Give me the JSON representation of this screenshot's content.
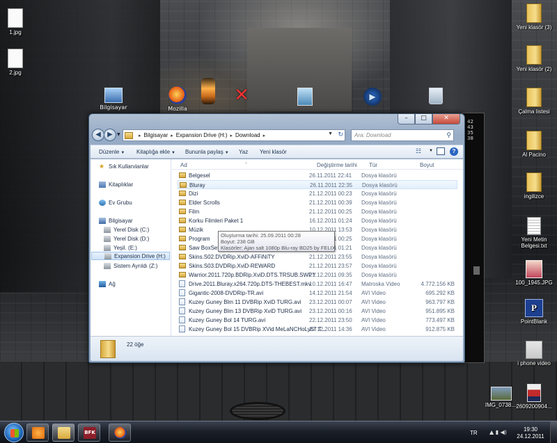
{
  "desktop": {
    "left_icons": [
      {
        "label": "1.jpg"
      },
      {
        "label": "2.jpg"
      }
    ],
    "top_icons": [
      {
        "label": "Bilgisayar"
      },
      {
        "label": "Mozilla"
      }
    ],
    "right_icons": [
      {
        "label": "Yeni klasör (3)"
      },
      {
        "label": "Yeni klasör (2)"
      },
      {
        "label": "Çalma listesi"
      },
      {
        "label": "Al Pacino"
      },
      {
        "label": "ingilizce"
      },
      {
        "label": "Yeni Metin Belgesi.txt"
      },
      {
        "label": "100_1945.JPG"
      },
      {
        "label": "PointBlank"
      },
      {
        "label": "i phone video"
      },
      {
        "label": "IMG_0738...."
      },
      {
        "label": "2609200904..."
      }
    ],
    "console_lines": [
      "42",
      "43",
      "35",
      "38"
    ]
  },
  "explorer": {
    "caption": {
      "minimize": "–",
      "maximize": "□",
      "close": "✕"
    },
    "address": {
      "crumbs": [
        "Bilgisayar",
        "Expansion Drive (H:)",
        "Download"
      ],
      "separator": "▸"
    },
    "search": {
      "placeholder": "Ara: Download"
    },
    "toolbar": {
      "organize": "Düzenle",
      "add_to_library": "Kitaplığa ekle",
      "share_with": "Bununla paylaş",
      "burn": "Yaz",
      "new_folder": "Yeni klasör"
    },
    "nav": {
      "favorites": "Sık Kullanılanlar",
      "libraries": "Kitaplıklar",
      "homegroup": "Ev Grubu",
      "computer": "Bilgisayar",
      "drives": [
        "Yerel Disk (C:)",
        "Yerel Disk (D:)",
        "Yeşil. (E:)",
        "Expansion Drive (H:)",
        "Sistem Ayrıldı (Z:)"
      ],
      "network": "Ağ"
    },
    "columns": {
      "name": "Ad",
      "date": "Değiştirme tarihi",
      "type": "Tür",
      "size": "Boyut"
    },
    "files": [
      {
        "name": "Belgesel",
        "date": "26.11.2011 22:41",
        "type": "Dosya klasörü",
        "size": "",
        "kind": "folder"
      },
      {
        "name": "Bluray",
        "date": "26.11.2011 22:35",
        "type": "Dosya klasörü",
        "size": "",
        "kind": "folder"
      },
      {
        "name": "Dizi",
        "date": "21.12.2011 00:23",
        "type": "Dosya klasörü",
        "size": "",
        "kind": "folder"
      },
      {
        "name": "Elder Scrolls",
        "date": "21.12.2011 00:39",
        "type": "Dosya klasörü",
        "size": "",
        "kind": "folder"
      },
      {
        "name": "Film",
        "date": "21.12.2011 00:25",
        "type": "Dosya klasörü",
        "size": "",
        "kind": "folder"
      },
      {
        "name": "Korku Filmleri Paket 1",
        "date": "16.12.2011 01:24",
        "type": "Dosya klasörü",
        "size": "",
        "kind": "folder"
      },
      {
        "name": "Müzik",
        "date": "10.12.2011 13:53",
        "type": "Dosya klasörü",
        "size": "",
        "kind": "folder"
      },
      {
        "name": "Program",
        "date": "21.12.2011 00:25",
        "type": "Dosya klasörü",
        "size": "",
        "kind": "folder"
      },
      {
        "name": "Saw BoxSet",
        "date": "21.12.2011 01:21",
        "type": "Dosya klasörü",
        "size": "",
        "kind": "folder"
      },
      {
        "name": "Skins.S02.DVDRip.XviD-AFFiNiTY",
        "date": "21.12.2011 23:55",
        "type": "Dosya klasörü",
        "size": "",
        "kind": "folder"
      },
      {
        "name": "Skins.S03.DVDRip.XviD-REWARD",
        "date": "21.12.2011 23:57",
        "type": "Dosya klasörü",
        "size": "",
        "kind": "folder"
      },
      {
        "name": "Warrior.2011.720p.BDRip.XviD.DTS.TRSUB.SWPY",
        "date": "21.12.2011 09:35",
        "type": "Dosya klasörü",
        "size": "",
        "kind": "folder"
      },
      {
        "name": "Drive.2011.Bluray.x264.720p.DTS-THEBEST.mkv",
        "date": "10.12.2011 16:47",
        "type": "Matroska Video",
        "size": "4.772.156 KB",
        "kind": "video"
      },
      {
        "name": "Gigantic-2008-DVDRip-TR.avi",
        "date": "14.12.2011 21:54",
        "type": "AVI Video",
        "size": "695.292 KB",
        "kind": "video"
      },
      {
        "name": "Kuzey Guney Blm 11 DVBRip XviD TURG.avi",
        "date": "23.12.2011 00:07",
        "type": "AVI Video",
        "size": "963.797 KB",
        "kind": "video"
      },
      {
        "name": "Kuzey Guney Blm 13 DVBRip XviD TURG.avi",
        "date": "23.12.2011 00:16",
        "type": "AVI Video",
        "size": "951.895 KB",
        "kind": "video"
      },
      {
        "name": "Kuzey Guney Bol 14 TURG.avi",
        "date": "22.12.2011 23:50",
        "type": "AVI Video",
        "size": "773.497 KB",
        "kind": "video"
      },
      {
        "name": "Kuzey Guney Bol 15 DVBRip XVid MeLaNCHoLy67 T...",
        "date": "22.12.2011 14:36",
        "type": "AVI Video",
        "size": "912.875 KB",
        "kind": "video"
      }
    ],
    "tooltip": {
      "line1": "Oluşturma tarihi: 25.09.2011 00:28",
      "line2": "Boyut: 238 GB",
      "line3": "Klasörler: Ajan salt 1080p Blu-ray  BD25 by FELIX, ..."
    },
    "details": {
      "count": "22 öğe"
    }
  },
  "taskbar": {
    "buttons": [
      {
        "name": "windows-media-player"
      },
      {
        "name": "windows-explorer"
      },
      {
        "name": "bfk",
        "label": "BFK"
      },
      {
        "name": "firefox"
      }
    ],
    "language": "TR",
    "time": "19:30",
    "date": "24.12.2011"
  }
}
